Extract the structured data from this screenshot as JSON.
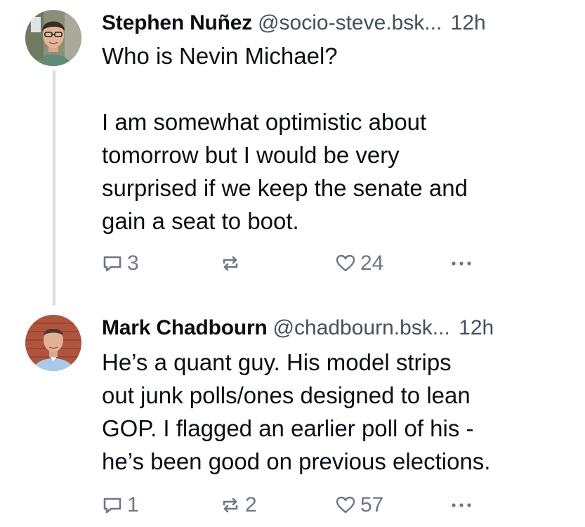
{
  "colors": {
    "text": "#0b0f14",
    "muted": "#44505c",
    "action_icon": "#6b7785",
    "thread_line": "#d4dbe2"
  },
  "icons": {
    "reply": "speech-bubble-icon",
    "repost": "repost-arrows-icon",
    "like": "heart-icon",
    "more": "ellipsis-icon"
  },
  "posts": [
    {
      "author_name": "Stephen Nuñez",
      "handle": "@socio-steve.bsk...",
      "time": "12h",
      "text": "Who is Nevin Michael?\n\nI am somewhat optimistic about\ntomorrow but I would be very\nsurprised if we keep the senate and\ngain a seat to boot.",
      "replies": "3",
      "reposts": "",
      "likes": "24"
    },
    {
      "author_name": "Mark Chadbourn",
      "handle": "@chadbourn.bsk...",
      "time": "12h",
      "text": "He’s a quant guy. His model strips\nout junk polls/ones designed to lean\nGOP. I flagged an earlier poll of his -\nhe’s been good on previous elections.",
      "replies": "1",
      "reposts": "2",
      "likes": "57"
    }
  ]
}
